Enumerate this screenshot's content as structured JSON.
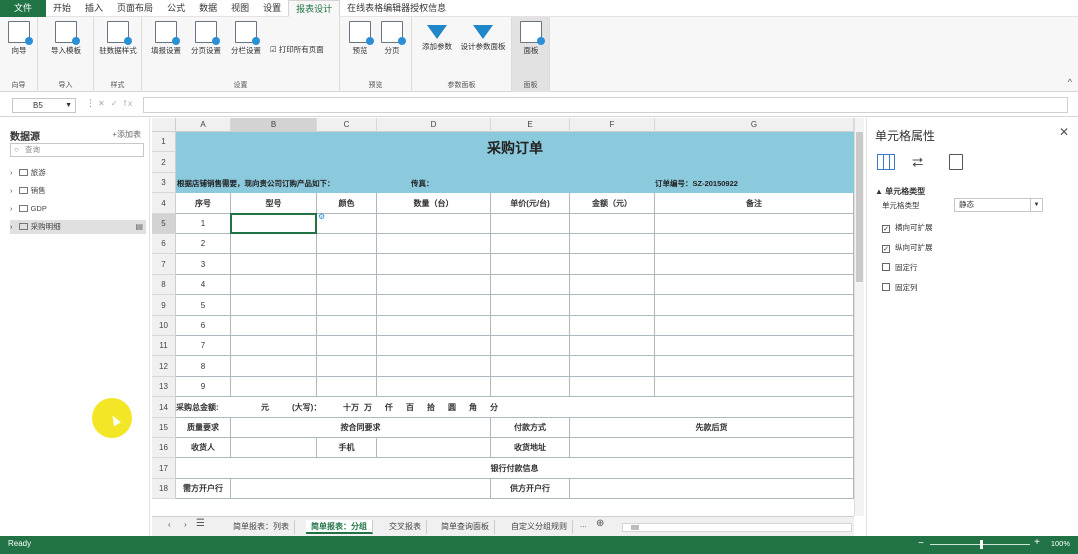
{
  "menu": {
    "file": "文件",
    "items": [
      "开始",
      "插入",
      "页面布局",
      "公式",
      "数据",
      "视图",
      "设置",
      "报表设计",
      "在线表格编辑器授权信息"
    ],
    "active_index": 7
  },
  "ribbon": {
    "groups": [
      {
        "label": "向导",
        "buttons": [
          "向导"
        ]
      },
      {
        "label": "导入",
        "buttons": [
          "导入模板"
        ]
      },
      {
        "label": "样式",
        "buttons": [
          "驻数据样式"
        ]
      },
      {
        "label": "设置",
        "buttons": [
          "填报设置",
          "分页设置",
          "分栏设置"
        ],
        "checkbox": "打印所有页面"
      },
      {
        "label": "预览",
        "buttons": [
          "预览",
          "分页"
        ]
      },
      {
        "label": "参数面板",
        "buttons": [
          "添加参数",
          "设计参数面板"
        ]
      },
      {
        "label": "面板",
        "buttons": [
          "面板"
        ]
      }
    ],
    "collapse": "^"
  },
  "formula_bar": {
    "name_box": "B5",
    "dots": "⋮",
    "icons": "✕ ✓ fx",
    "value": ""
  },
  "left_panel": {
    "title": "数据源",
    "add_label": "+添加表",
    "search_placeholder": "查询",
    "items": [
      {
        "label": "旅游"
      },
      {
        "label": "销售"
      },
      {
        "label": "GDP"
      },
      {
        "label": "采购明细"
      }
    ]
  },
  "sheet": {
    "columns": [
      "A",
      "B",
      "C",
      "D",
      "E",
      "F",
      "G"
    ],
    "selected_column": "B",
    "rows": [
      "1",
      "2",
      "3",
      "4",
      "5",
      "6",
      "7",
      "8",
      "9",
      "10",
      "11",
      "12",
      "13",
      "14",
      "15",
      "16",
      "17",
      "18"
    ],
    "selected_row": "5",
    "title": "采购订单",
    "row3_left": "根据店铺销售需要，现向贵公司订购产品如下：",
    "row3_mid": "传真：",
    "row3_right": "订单编号：SZ-20150922",
    "headers": [
      "序号",
      "型号",
      "颜色",
      "数量（台）",
      "单价(元/台)",
      "金额（元）",
      "备注"
    ],
    "item_numbers": [
      "1",
      "2",
      "3",
      "4",
      "5",
      "6",
      "7",
      "8",
      "9"
    ],
    "total_row": {
      "label": "采购总金额:",
      "yuan": "元",
      "daxie": "(大写)：",
      "units": [
        "十万",
        "万",
        "仟",
        "百",
        "拾",
        "圆",
        "角",
        "分"
      ]
    },
    "row15": {
      "a": "质量要求",
      "b": "按合同要求",
      "e": "付款方式",
      "f": "先款后货"
    },
    "row16": {
      "a": "收货人",
      "c": "手机",
      "e": "收货地址"
    },
    "row17": "银行付款信息",
    "row18": {
      "a": "需方开户行",
      "e": "供方开户行"
    }
  },
  "sheet_tabs": {
    "tabs": [
      "简单报表：列表",
      "简单报表：分组",
      "交叉报表",
      "简单查询面板",
      "自定义分组规则"
    ],
    "active_index": 1,
    "more": "...",
    "add": "+"
  },
  "right_panel": {
    "title": "单元格属性",
    "close": "✕",
    "section": "单元格类型",
    "type_label": "单元格类型",
    "type_value": "静态",
    "checkboxes": [
      {
        "label": "横向可扩展",
        "checked": true
      },
      {
        "label": "纵向可扩展",
        "checked": true
      },
      {
        "label": "固定行",
        "checked": false
      },
      {
        "label": "固定列",
        "checked": false
      }
    ]
  },
  "status": {
    "text": "Ready",
    "zoom": "100%"
  },
  "colors": {
    "accent": "#217346",
    "band": "#8bc9dc"
  }
}
